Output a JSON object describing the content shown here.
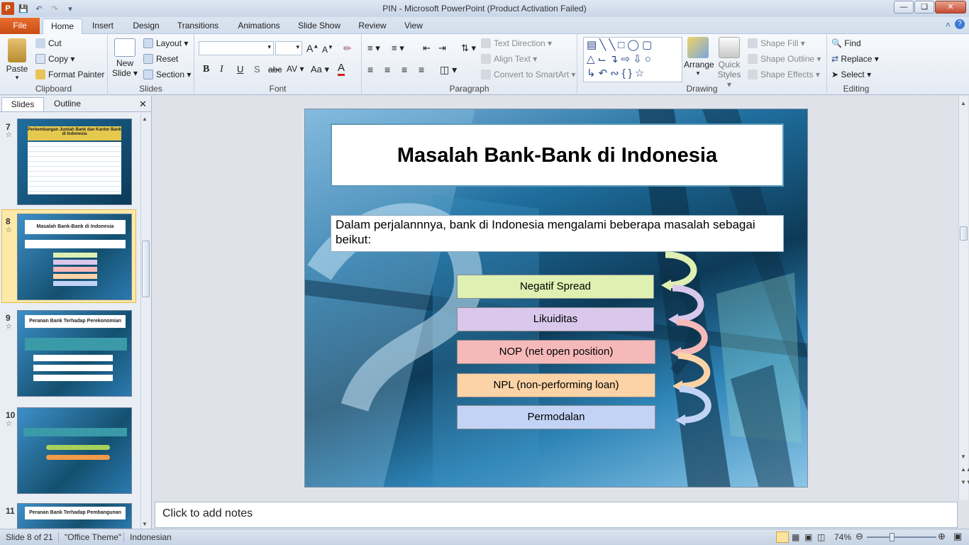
{
  "window": {
    "title": "PIN  -  Microsoft PowerPoint (Product Activation Failed)"
  },
  "tabs": [
    "File",
    "Home",
    "Insert",
    "Design",
    "Transitions",
    "Animations",
    "Slide Show",
    "Review",
    "View"
  ],
  "ribbon": {
    "clipboard": {
      "paste": "Paste",
      "cut": "Cut",
      "copy": "Copy",
      "format_painter": "Format Painter",
      "label": "Clipboard"
    },
    "slides": {
      "new_slide_1": "New",
      "new_slide_2": "Slide",
      "layout": "Layout",
      "reset": "Reset",
      "section": "Section",
      "label": "Slides"
    },
    "font": {
      "label": "Font",
      "bold": "B",
      "italic": "I",
      "underline": "U",
      "shadow": "S",
      "strike": "abc",
      "spacing": "AV",
      "case": "Aa",
      "color": "A"
    },
    "paragraph": {
      "text_direction": "Text Direction",
      "align_text": "Align Text",
      "convert_smartart": "Convert to SmartArt",
      "label": "Paragraph"
    },
    "drawing": {
      "arrange": "Arrange",
      "quick_styles_1": "Quick",
      "quick_styles_2": "Styles",
      "shape_fill": "Shape Fill",
      "shape_outline": "Shape Outline",
      "shape_effects": "Shape Effects",
      "label": "Drawing"
    },
    "editing": {
      "find": "Find",
      "replace": "Replace",
      "select": "Select",
      "label": "Editing"
    }
  },
  "left_pane": {
    "tab_slides": "Slides",
    "tab_outline": "Outline",
    "thumbnails": [
      {
        "num": "7",
        "title": "Perkembangan Jumlah Bank dan Kantor Bank di Indonesia"
      },
      {
        "num": "8",
        "title": "Masalah Bank-Bank di Indonesia"
      },
      {
        "num": "9",
        "title": "Peranan Bank Terhadap Perekonomian"
      },
      {
        "num": "10",
        "title": ""
      },
      {
        "num": "11",
        "title": "Peranan Bank Terhadap Pembangunan"
      }
    ]
  },
  "slide": {
    "title": "Masalah Bank-Bank di Indonesia",
    "body": "Dalam perjalannnya, bank di Indonesia mengalami beberapa masalah sebagai beikut:",
    "items": [
      {
        "label": "Negatif Spread",
        "color": "#dff0b3"
      },
      {
        "label": "Likuiditas",
        "color": "#d9c8ec"
      },
      {
        "label": "NOP (net  open position)",
        "color": "#f6b9b9"
      },
      {
        "label": "NPL (non-performing loan)",
        "color": "#fbd3a6"
      },
      {
        "label": "Permodalan",
        "color": "#c3d3f6"
      }
    ]
  },
  "notes": {
    "placeholder": "Click to add notes"
  },
  "status": {
    "slide": "Slide 8 of 21",
    "theme": "\"Office Theme\"",
    "language": "Indonesian",
    "zoom": "74%"
  }
}
